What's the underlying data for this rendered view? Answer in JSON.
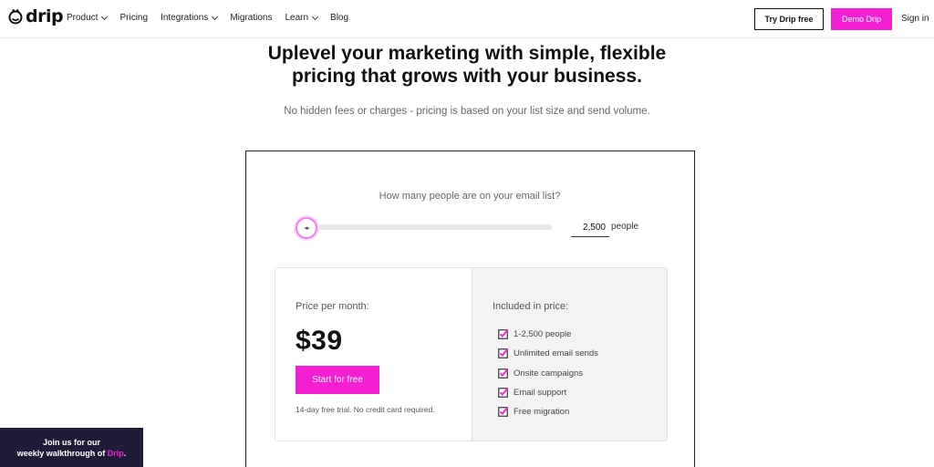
{
  "nav": {
    "logo_text": "drip",
    "links": [
      {
        "label": "Product",
        "has_dropdown": true
      },
      {
        "label": "Pricing",
        "has_dropdown": false
      },
      {
        "label": "Integrations",
        "has_dropdown": true
      },
      {
        "label": "Migrations",
        "has_dropdown": false
      },
      {
        "label": "Learn",
        "has_dropdown": true
      },
      {
        "label": "Blog",
        "has_dropdown": false
      }
    ],
    "try_free_label": "Try Drip free",
    "demo_label": "Demo Drip",
    "sign_in_label": "Sign in"
  },
  "hero": {
    "headline_line1": "Uplevel your marketing with simple, flexible",
    "headline_line2": "pricing that grows with your business.",
    "subhead": "No hidden fees or charges - pricing is based on your list size and send volume."
  },
  "calculator": {
    "question": "How many people are on your email list?",
    "slider_fraction": 0,
    "count_value": "2,500",
    "count_unit": "people",
    "thumb_glyph": "◂▸"
  },
  "pricing": {
    "price_label": "Price per month:",
    "price_value": "$39",
    "cta_label": "Start for free",
    "trial_note": "14-day free trial. No credit card required.",
    "included_label": "Included in price:",
    "features": [
      "1-2,500 people",
      "Unlimited email sends",
      "Onsite campaigns",
      "Email support",
      "Free migration"
    ]
  },
  "walkthrough": {
    "line1": "Join us for our",
    "line2_prefix": "weekly walkthrough of ",
    "line2_accent": "Drip",
    "line2_suffix": "."
  },
  "colors": {
    "brand_pink": "#f41fd5",
    "banner_bg": "#201b36",
    "feature_bg": "#f3f3f3"
  },
  "icons": {
    "logo": "drip-smile-icon",
    "dropdown": "chevron-down-icon",
    "feature": "checkbox-checked-icon",
    "slider": "slider-arrows-icon"
  }
}
